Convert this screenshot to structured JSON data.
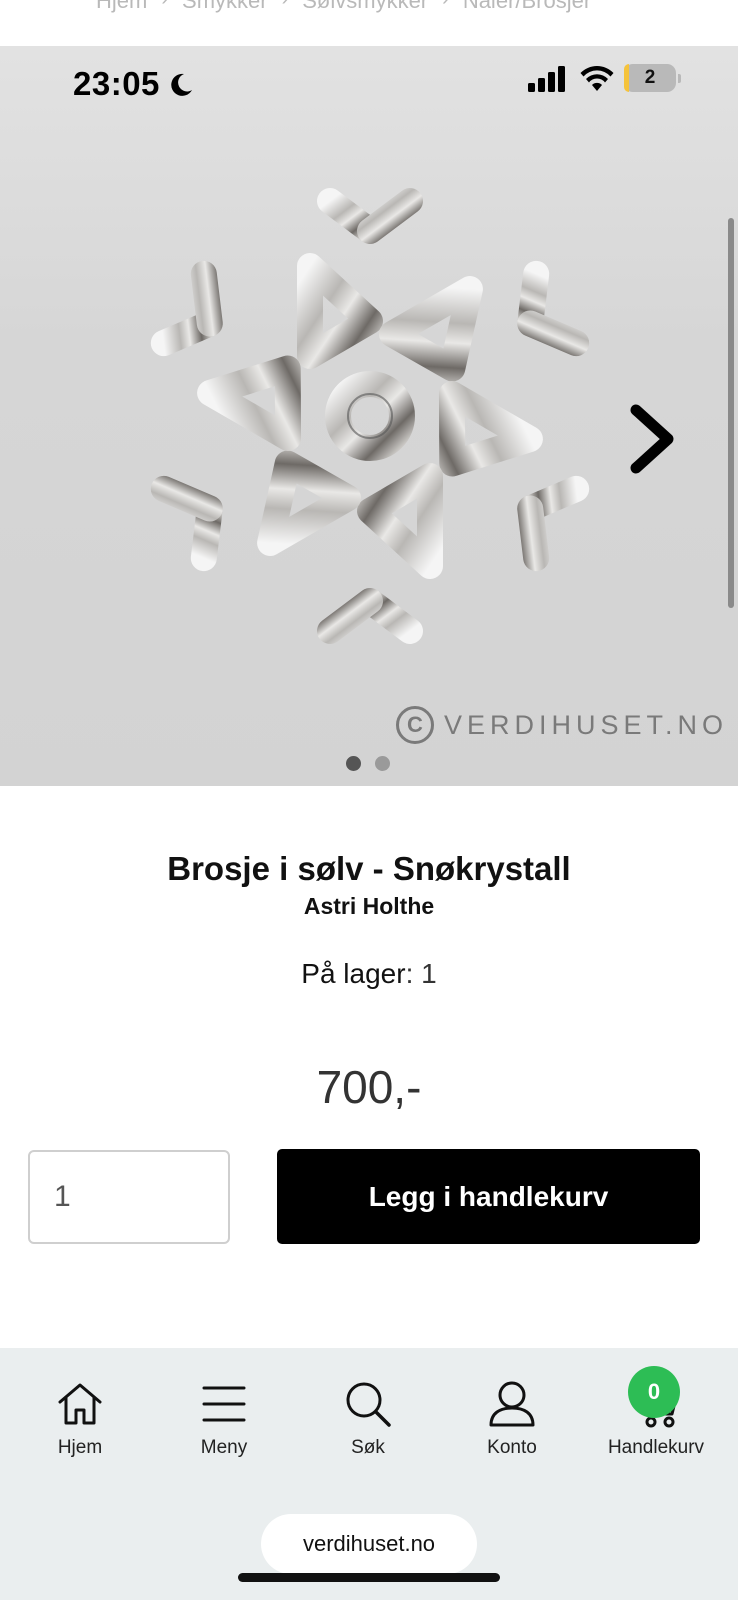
{
  "breadcrumb": {
    "items": [
      "Hjem",
      "Smykker",
      "Sølvsmykker",
      "Nåler/Brosjer"
    ],
    "separator": "›"
  },
  "status_bar": {
    "time": "23:05",
    "battery": "2"
  },
  "gallery": {
    "watermark_symbol": "C",
    "watermark_text": "VERDIHUSET.NO",
    "image_count": 2,
    "active_image": 1
  },
  "product": {
    "title": "Brosje i sølv - Snøkrystall",
    "brand": "Astri Holthe",
    "stock_label": "På lager",
    "stock_value": ": 1",
    "price": "700,-"
  },
  "cart_form": {
    "quantity": "1",
    "add_button_label": "Legg i handlekurv"
  },
  "bottom_nav": {
    "items": [
      {
        "label": "Hjem",
        "icon": "home-icon"
      },
      {
        "label": "Meny",
        "icon": "menu-icon"
      },
      {
        "label": "Søk",
        "icon": "search-icon"
      },
      {
        "label": "Konto",
        "icon": "user-icon"
      },
      {
        "label": "Handlekurv",
        "icon": "cart-icon"
      }
    ],
    "cart_count": "0"
  },
  "browser": {
    "url": "verdihuset.no"
  },
  "colors": {
    "badge": "#2dbd55",
    "button": "#000000",
    "bottom_bar": "#eaeeef"
  }
}
